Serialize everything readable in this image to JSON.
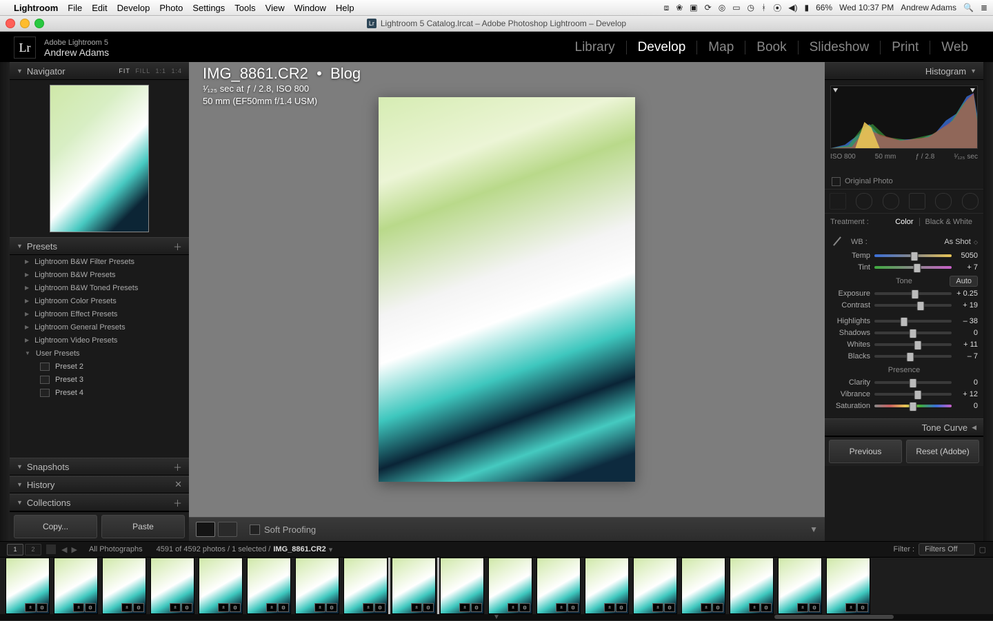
{
  "menubar": {
    "app": "Lightroom",
    "items": [
      "File",
      "Edit",
      "Develop",
      "Photo",
      "Settings",
      "Tools",
      "View",
      "Window",
      "Help"
    ],
    "status": {
      "battery": "66%",
      "datetime": "Wed 10:37 PM",
      "user": "Andrew Adams"
    }
  },
  "window": {
    "title": "Lightroom 5 Catalog.lrcat – Adobe Photoshop Lightroom – Develop"
  },
  "identity": {
    "product": "Adobe Lightroom 5",
    "user": "Andrew Adams"
  },
  "modules": {
    "items": [
      "Library",
      "Develop",
      "Map",
      "Book",
      "Slideshow",
      "Print",
      "Web"
    ],
    "active": "Develop"
  },
  "left": {
    "navigator": {
      "title": "Navigator",
      "zoom_modes": [
        "FIT",
        "FILL",
        "1:1",
        "1:4"
      ],
      "active": "FIT"
    },
    "presets": {
      "title": "Presets",
      "folders": [
        "Lightroom B&W Filter Presets",
        "Lightroom B&W Presets",
        "Lightroom B&W Toned Presets",
        "Lightroom Color Presets",
        "Lightroom Effect Presets",
        "Lightroom General Presets",
        "Lightroom Video Presets"
      ],
      "user_folder": "User Presets",
      "user": [
        "Preset 2",
        "Preset 3",
        "Preset 4"
      ]
    },
    "snapshots": "Snapshots",
    "history": "History",
    "collections": "Collections",
    "copy": "Copy...",
    "paste": "Paste"
  },
  "image": {
    "filename": "IMG_8861.CR2",
    "collection": "Blog",
    "exposure": "¹⁄₁₂₅ sec at ƒ / 2.8, ISO 800",
    "lens": "50 mm (EF50mm f/1.4 USM)"
  },
  "center_toolbar": {
    "soft_proof": "Soft Proofing"
  },
  "right": {
    "histogram": {
      "title": "Histogram",
      "iso": "ISO 800",
      "focal": "50 mm",
      "aperture": "ƒ / 2.8",
      "shutter": "¹⁄₁₂₅ sec",
      "original": "Original Photo"
    },
    "treatment": {
      "label": "Treatment :",
      "color": "Color",
      "bw": "Black & White"
    },
    "wb": {
      "label": "WB :",
      "mode": "As Shot"
    },
    "sliders": {
      "temp": {
        "label": "Temp",
        "value": "5050",
        "pos": 52
      },
      "tint": {
        "label": "Tint",
        "value": "+ 7",
        "pos": 55
      },
      "tone_label": "Tone",
      "auto": "Auto",
      "exposure": {
        "label": "Exposure",
        "value": "+ 0.25",
        "pos": 53
      },
      "contrast": {
        "label": "Contrast",
        "value": "+ 19",
        "pos": 60
      },
      "highlights": {
        "label": "Highlights",
        "value": "– 38",
        "pos": 38
      },
      "shadows": {
        "label": "Shadows",
        "value": "0",
        "pos": 50
      },
      "whites": {
        "label": "Whites",
        "value": "+ 11",
        "pos": 56
      },
      "blacks": {
        "label": "Blacks",
        "value": "– 7",
        "pos": 46
      },
      "presence_label": "Presence",
      "clarity": {
        "label": "Clarity",
        "value": "0",
        "pos": 50
      },
      "vibrance": {
        "label": "Vibrance",
        "value": "+ 12",
        "pos": 56
      },
      "saturation": {
        "label": "Saturation",
        "value": "0",
        "pos": 50
      }
    },
    "tonecurve": "Tone Curve",
    "previous": "Previous",
    "reset": "Reset (Adobe)"
  },
  "filmstrip": {
    "source": "All Photographs",
    "count": "4591 of 4592 photos / 1 selected /",
    "current": "IMG_8861.CR2",
    "filter_label": "Filter :",
    "filter_value": "Filters Off"
  }
}
